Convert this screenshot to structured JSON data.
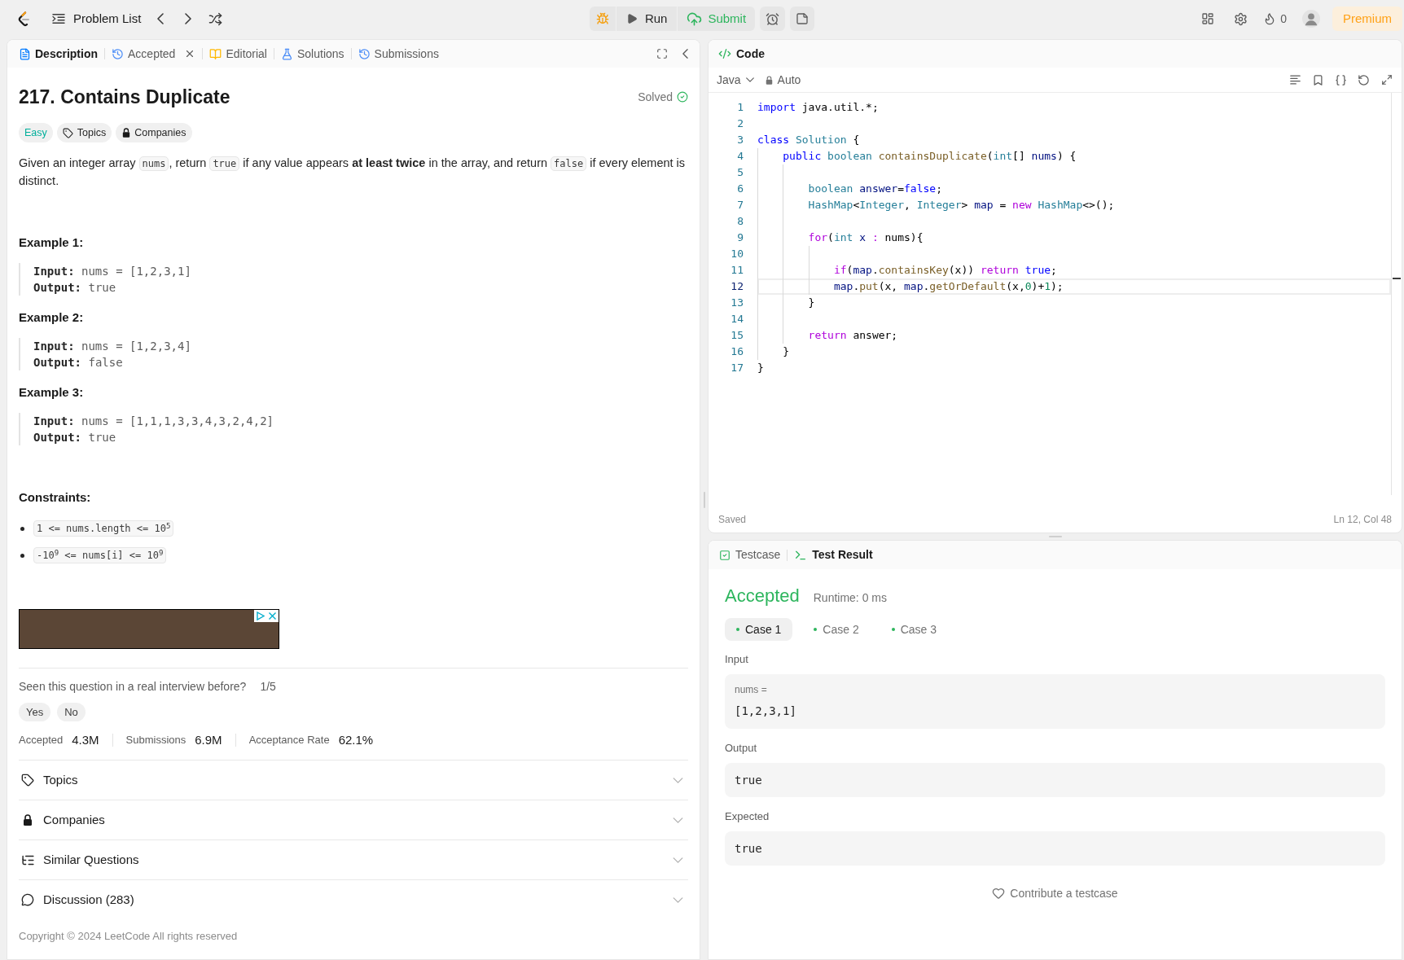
{
  "top_bar": {
    "problem_list": "Problem List",
    "run": "Run",
    "submit": "Submit",
    "streak": "0",
    "premium": "Premium"
  },
  "description_panel": {
    "tabs": [
      {
        "label": "Description",
        "selected": true,
        "closable": false
      },
      {
        "label": "Accepted",
        "selected": false,
        "closable": true
      },
      {
        "label": "Editorial",
        "selected": false,
        "closable": false
      },
      {
        "label": "Solutions",
        "selected": false,
        "closable": false
      },
      {
        "label": "Submissions",
        "selected": false,
        "closable": false
      }
    ],
    "title": "217. Contains Duplicate",
    "status": "Solved",
    "tags": [
      {
        "kind": "difficulty",
        "label": "Easy"
      },
      {
        "kind": "topics",
        "label": "Topics"
      },
      {
        "kind": "companies",
        "label": "Companies"
      }
    ],
    "statement": [
      {
        "kind": "text",
        "text": "Given an integer array "
      },
      {
        "kind": "code",
        "text": "nums"
      },
      {
        "kind": "text",
        "text": ", return "
      },
      {
        "kind": "code",
        "text": "true"
      },
      {
        "kind": "text",
        "text": " if any value appears **at least twice** in the array, and return "
      },
      {
        "kind": "code",
        "text": "false"
      },
      {
        "kind": "text",
        "text": " if every element is distinct."
      }
    ],
    "examples": [
      {
        "title": "Example 1:",
        "lines": [
          {
            "label": "Input:",
            "value": "nums = [1,2,3,1]"
          },
          {
            "label": "Output:",
            "value": "true"
          }
        ]
      },
      {
        "title": "Example 2:",
        "lines": [
          {
            "label": "Input:",
            "value": "nums = [1,2,3,4]"
          },
          {
            "label": "Output:",
            "value": "false"
          }
        ]
      },
      {
        "title": "Example 3:",
        "lines": [
          {
            "label": "Input:",
            "value": "nums = [1,1,1,3,3,4,3,2,4,2]"
          },
          {
            "label": "Output:",
            "value": "true"
          }
        ]
      }
    ],
    "constraints_title": "Constraints:",
    "constraints": [
      "1 <= nums.length <= 10$^{5}$",
      "-10$^{9}$ <= nums[i] <= 10$^{9}$"
    ],
    "interview": {
      "question": "Seen this question in a real interview before?",
      "count": "1/5",
      "answers": [
        "Yes",
        "No"
      ]
    },
    "stats": [
      {
        "label": "Accepted",
        "value": "4.3M"
      },
      {
        "label": "Submissions",
        "value": "6.9M"
      },
      {
        "label": "Acceptance Rate",
        "value": "62.1%"
      }
    ],
    "sections": [
      {
        "label": "Topics",
        "expanded": false
      },
      {
        "label": "Companies",
        "expanded": false
      },
      {
        "label": "Similar Questions",
        "expanded": false
      },
      {
        "label": "Discussion (283)",
        "expanded": false
      }
    ],
    "copyright": "Copyright © 2024 LeetCode All rights reserved"
  },
  "code_panel": {
    "tab": "Code",
    "language": "Java",
    "mode": "Auto",
    "lines": [
      {
        "number": "1",
        "current": false,
        "tokens": [
          {
            "kind": "keyword",
            "text": "import"
          },
          {
            "kind": "plain",
            "text": " java.util.*;"
          }
        ]
      },
      {
        "number": "2",
        "current": false
      },
      {
        "number": "3",
        "current": false,
        "tokens": [
          {
            "kind": "keyword",
            "text": "class"
          },
          {
            "kind": "type",
            "text": " Solution"
          },
          {
            "kind": "plain",
            "text": " {"
          }
        ]
      },
      {
        "number": "4",
        "current": false,
        "tokens": [
          {
            "kind": "keyword",
            "text": "    public"
          },
          {
            "kind": "type",
            "text": " boolean"
          },
          {
            "kind": "function",
            "text": " containsDuplicate"
          },
          {
            "kind": "plain",
            "text": "("
          },
          {
            "kind": "type",
            "text": "int"
          },
          {
            "kind": "plain",
            "text": "[]"
          },
          {
            "kind": "variable",
            "text": " nums"
          },
          {
            "kind": "plain",
            "text": ") {"
          }
        ]
      },
      {
        "number": "5",
        "current": false
      },
      {
        "number": "6",
        "current": false,
        "tokens": [
          {
            "kind": "type",
            "text": "        boolean"
          },
          {
            "kind": "variable",
            "text": " answer"
          },
          {
            "kind": "plain",
            "text": "="
          },
          {
            "kind": "keyword",
            "text": "false"
          },
          {
            "kind": "plain",
            "text": ";"
          }
        ]
      },
      {
        "number": "7",
        "current": false,
        "tokens": [
          {
            "kind": "type",
            "text": "        HashMap"
          },
          {
            "kind": "plain",
            "text": "<"
          },
          {
            "kind": "type",
            "text": "Integer"
          },
          {
            "kind": "plain",
            "text": ", "
          },
          {
            "kind": "type",
            "text": "Integer"
          },
          {
            "kind": "plain",
            "text": "> "
          },
          {
            "kind": "variable",
            "text": "map"
          },
          {
            "kind": "plain",
            "text": " = "
          },
          {
            "kind": "control",
            "text": "new"
          },
          {
            "kind": "type",
            "text": " HashMap"
          },
          {
            "kind": "plain",
            "text": "<>();"
          }
        ]
      },
      {
        "number": "8",
        "current": false
      },
      {
        "number": "9",
        "current": false,
        "tokens": [
          {
            "kind": "control",
            "text": "        for"
          },
          {
            "kind": "plain",
            "text": "("
          },
          {
            "kind": "type",
            "text": "int"
          },
          {
            "kind": "variable",
            "text": " x"
          },
          {
            "kind": "control",
            "text": " :"
          },
          {
            "kind": "plain",
            "text": " nums){"
          }
        ]
      },
      {
        "number": "10",
        "current": false
      },
      {
        "number": "11",
        "current": false,
        "tokens": [
          {
            "kind": "control",
            "text": "            if"
          },
          {
            "kind": "plain",
            "text": "("
          },
          {
            "kind": "variable",
            "text": "map"
          },
          {
            "kind": "plain",
            "text": "."
          },
          {
            "kind": "function",
            "text": "containsKey"
          },
          {
            "kind": "plain",
            "text": "(x)) "
          },
          {
            "kind": "control",
            "text": "return"
          },
          {
            "kind": "keyword",
            "text": " true"
          },
          {
            "kind": "plain",
            "text": ";"
          }
        ]
      },
      {
        "number": "12",
        "current": true,
        "tokens": [
          {
            "kind": "variable",
            "text": "            map"
          },
          {
            "kind": "plain",
            "text": "."
          },
          {
            "kind": "function",
            "text": "put"
          },
          {
            "kind": "plain",
            "text": "(x, "
          },
          {
            "kind": "variable",
            "text": "map"
          },
          {
            "kind": "plain",
            "text": "."
          },
          {
            "kind": "function",
            "text": "getOrDefault"
          },
          {
            "kind": "plain",
            "text": "(x,"
          },
          {
            "kind": "number",
            "text": "0"
          },
          {
            "kind": "plain",
            "text": ")+"
          },
          {
            "kind": "number",
            "text": "1"
          },
          {
            "kind": "plain",
            "text": ");"
          }
        ]
      },
      {
        "number": "13",
        "current": false,
        "tokens": [
          {
            "kind": "plain",
            "text": "        }"
          }
        ]
      },
      {
        "number": "14",
        "current": false
      },
      {
        "number": "15",
        "current": false,
        "tokens": [
          {
            "kind": "control",
            "text": "        return"
          },
          {
            "kind": "plain",
            "text": " answer;"
          }
        ]
      },
      {
        "number": "16",
        "current": false,
        "tokens": [
          {
            "kind": "plain",
            "text": "    }"
          }
        ]
      },
      {
        "number": "17",
        "current": false,
        "tokens": [
          {
            "kind": "plain",
            "text": "}"
          }
        ]
      }
    ],
    "status": "Saved",
    "cursor": "Ln 12, Col 48"
  },
  "test_panel": {
    "tabs": [
      {
        "label": "Testcase",
        "selected": false
      },
      {
        "label": "Test Result",
        "selected": true
      }
    ],
    "verdict": "Accepted",
    "runtime": "Runtime: 0 ms",
    "cases": [
      {
        "label": "Case 1",
        "selected": true
      },
      {
        "label": "Case 2",
        "selected": false
      },
      {
        "label": "Case 3",
        "selected": false
      }
    ],
    "input": {
      "label": "Input",
      "variables": [
        {
          "name": "nums =",
          "value": "[1,2,3,1]"
        }
      ]
    },
    "output": {
      "label": "Output",
      "value": "true"
    },
    "expected": {
      "label": "Expected",
      "value": "true"
    },
    "contribute": "Contribute a testcase"
  }
}
